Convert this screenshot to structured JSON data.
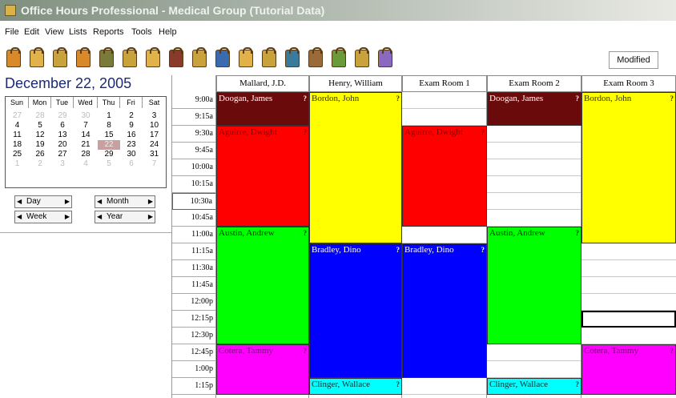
{
  "window": {
    "title": "Office Hours Professional - Medical Group (Tutorial Data)"
  },
  "menu": [
    "File",
    "Edit",
    "View",
    "Lists",
    "Reports",
    "Tools",
    "Help"
  ],
  "toolbar": {
    "status": "Modified",
    "icon_colors": [
      "#d88a2a",
      "#e2b24a",
      "#c9a23b",
      "#d88a2a",
      "#7a7a3a",
      "#c9a23b",
      "#e2b24a",
      "#8a3a2a",
      "#c9a23b",
      "#3a6ab0",
      "#e2b24a",
      "#c9a23b",
      "#3a7a9a",
      "#9a6a3a",
      "#6a9a3a",
      "#c9a23b",
      "#8a6ac0"
    ]
  },
  "calendar": {
    "date_heading": "December 22, 2005",
    "weekdays": [
      "Sun",
      "Mon",
      "Tue",
      "Wed",
      "Thu",
      "Fri",
      "Sat"
    ],
    "weeks": [
      [
        "27",
        "28",
        "29",
        "30",
        "1",
        "2",
        "3"
      ],
      [
        "4",
        "5",
        "6",
        "7",
        "8",
        "9",
        "10"
      ],
      [
        "11",
        "12",
        "13",
        "14",
        "15",
        "16",
        "17"
      ],
      [
        "18",
        "19",
        "20",
        "21",
        "22",
        "23",
        "24"
      ],
      [
        "25",
        "26",
        "27",
        "28",
        "29",
        "30",
        "31"
      ],
      [
        "1",
        "2",
        "3",
        "4",
        "5",
        "6",
        "7"
      ]
    ],
    "nav": {
      "day": "Day",
      "week": "Week",
      "month": "Month",
      "year": "Year"
    }
  },
  "schedule": {
    "columns": [
      "Mallard, J.D.",
      "Henry, William",
      "Exam Room 1",
      "Exam Room 2",
      "Exam Room 3"
    ],
    "times": [
      "9:00a",
      "9:15a",
      "9:30a",
      "9:45a",
      "10:00a",
      "10:15a",
      "10:30a",
      "10:45a",
      "11:00a",
      "11:15a",
      "11:30a",
      "11:45a",
      "12:00p",
      "12:15p",
      "12:30p",
      "12:45p",
      "1:00p",
      "1:15p"
    ],
    "current_time": "10:30a",
    "appointments": [
      {
        "name": "Doogan, James",
        "col": 0,
        "start": 0,
        "slots": 2,
        "color": "#6b0a0a",
        "text_color": "#ffffff"
      },
      {
        "name": "Aguirre, Dwight",
        "col": 0,
        "start": 2,
        "slots": 6,
        "color": "#ff0000",
        "text_color": "#800000"
      },
      {
        "name": "Austin, Andrew",
        "col": 0,
        "start": 8,
        "slots": 7,
        "color": "#00ff00",
        "text_color": "#003300"
      },
      {
        "name": "Cotera, Tammy",
        "col": 0,
        "start": 15,
        "slots": 3,
        "color": "#ff00ff",
        "text_color": "#800080"
      },
      {
        "name": "Bordon, John",
        "col": 1,
        "start": 0,
        "slots": 9,
        "color": "#ffff00",
        "text_color": "#333300"
      },
      {
        "name": "Bradley, Dino",
        "col": 1,
        "start": 9,
        "slots": 8,
        "color": "#0000ff",
        "text_color": "#ffffff"
      },
      {
        "name": "Clinger, Wallace",
        "col": 1,
        "start": 17,
        "slots": 1,
        "color": "#00ffff",
        "text_color": "#003333"
      },
      {
        "name": "Aguirre, Dwight",
        "col": 2,
        "start": 2,
        "slots": 6,
        "color": "#ff0000",
        "text_color": "#800000"
      },
      {
        "name": "Bradley, Dino",
        "col": 2,
        "start": 9,
        "slots": 8,
        "color": "#0000ff",
        "text_color": "#ffffff"
      },
      {
        "name": "Doogan, James",
        "col": 3,
        "start": 0,
        "slots": 2,
        "color": "#6b0a0a",
        "text_color": "#ffffff"
      },
      {
        "name": "Austin, Andrew",
        "col": 3,
        "start": 8,
        "slots": 7,
        "color": "#00ff00",
        "text_color": "#003300"
      },
      {
        "name": "Clinger, Wallace",
        "col": 3,
        "start": 17,
        "slots": 1,
        "color": "#00ffff",
        "text_color": "#003333"
      },
      {
        "name": "Bordon, John",
        "col": 4,
        "start": 0,
        "slots": 9,
        "color": "#ffff00",
        "text_color": "#333300"
      },
      {
        "name": "Cotera, Tammy",
        "col": 4,
        "start": 15,
        "slots": 3,
        "color": "#ff00ff",
        "text_color": "#800080"
      }
    ]
  }
}
